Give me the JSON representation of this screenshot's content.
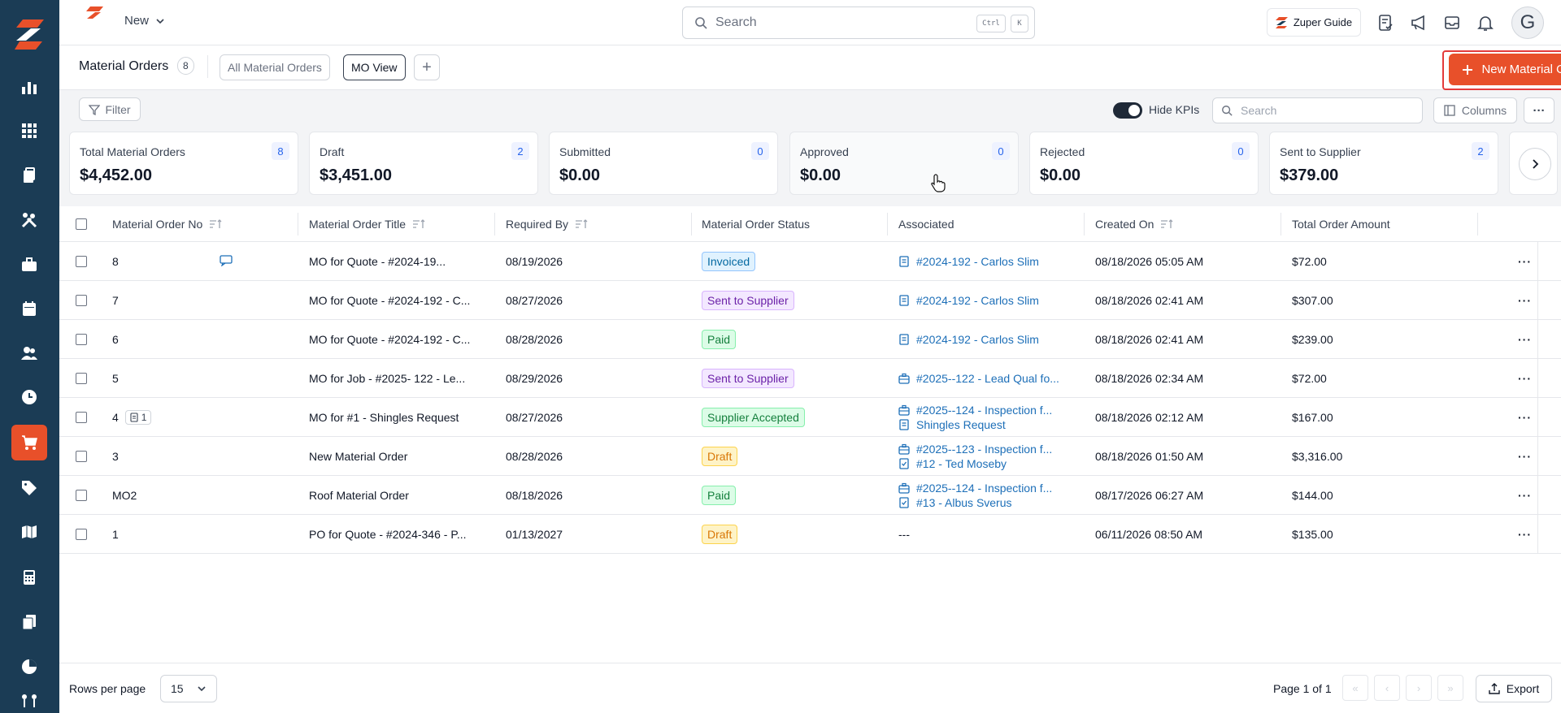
{
  "colors": {
    "sidebar": "#1b3c55",
    "accent": "#e8502a",
    "link": "#1d6fb8"
  },
  "topbar": {
    "new_label": "New",
    "search_placeholder": "Search",
    "kbd_ctrl": "Ctrl",
    "kbd_k": "K",
    "guide_label": "Zuper Guide",
    "avatar_initial": "G"
  },
  "header": {
    "title": "Material Orders",
    "count": "8",
    "tabs": [
      {
        "label": "All Material Orders"
      },
      {
        "label": "MO View"
      }
    ],
    "add_view": "+",
    "cta_label": "New Material Order"
  },
  "toolbar": {
    "filter_label": "Filter",
    "hide_kpis_label": "Hide KPIs",
    "search_placeholder": "Search",
    "columns_label": "Columns",
    "more_label": "···"
  },
  "kpis": [
    {
      "label": "Total Material Orders",
      "count": "8",
      "value": "$4,452.00"
    },
    {
      "label": "Draft",
      "count": "2",
      "value": "$3,451.00"
    },
    {
      "label": "Submitted",
      "count": "0",
      "value": "$0.00"
    },
    {
      "label": "Approved",
      "count": "0",
      "value": "$0.00"
    },
    {
      "label": "Rejected",
      "count": "0",
      "value": "$0.00"
    },
    {
      "label": "Sent to Supplier",
      "count": "2",
      "value": "$379.00"
    }
  ],
  "table": {
    "columns": [
      "Material Order No",
      "Material Order Title",
      "Required By",
      "Material Order Status",
      "Associated",
      "Created On",
      "Total Order Amount"
    ],
    "rows": [
      {
        "no": "8",
        "title": "MO for Quote - #2024-19...",
        "required": "08/19/2026",
        "status": "Invoiced",
        "assoc1": "#2024-192 - Carlos Slim",
        "assoc2": "",
        "created": "08/18/2026 05:05 AM",
        "amount": "$72.00"
      },
      {
        "no": "7",
        "title": "MO for Quote - #2024-192 - C...",
        "required": "08/27/2026",
        "status": "Sent to Supplier",
        "assoc1": "#2024-192 - Carlos Slim",
        "assoc2": "",
        "created": "08/18/2026 02:41 AM",
        "amount": "$307.00"
      },
      {
        "no": "6",
        "title": "MO for Quote - #2024-192 - C...",
        "required": "08/28/2026",
        "status": "Paid",
        "assoc1": "#2024-192 - Carlos Slim",
        "assoc2": "",
        "created": "08/18/2026 02:41 AM",
        "amount": "$239.00"
      },
      {
        "no": "5",
        "title": "MO for Job - #2025- 122 - Le...",
        "required": "08/29/2026",
        "status": "Sent to Supplier",
        "assoc1": "#2025--122 - Lead Qual fo...",
        "assoc2": "",
        "created": "08/18/2026 02:34 AM",
        "amount": "$72.00"
      },
      {
        "no": "4",
        "no_chip": "1",
        "title": "MO for #1 - Shingles Request",
        "required": "08/27/2026",
        "status": "Supplier Accepted",
        "assoc1": "#2025--124 - Inspection f...",
        "assoc2": "Shingles Request",
        "created": "08/18/2026 02:12 AM",
        "amount": "$167.00"
      },
      {
        "no": "3",
        "title": "New Material Order",
        "required": "08/28/2026",
        "status": "Draft",
        "assoc1": "#2025--123 - Inspection f...",
        "assoc2": "#12 - Ted Moseby",
        "created": "08/18/2026 01:50 AM",
        "amount": "$3,316.00"
      },
      {
        "no": "MO2",
        "title": "Roof Material Order",
        "required": "08/18/2026",
        "status": "Paid",
        "assoc1": "#2025--124 - Inspection f...",
        "assoc2": "#13 - Albus Sverus",
        "created": "08/17/2026 06:27 AM",
        "amount": "$144.00"
      },
      {
        "no": "1",
        "title": "PO for Quote - #2024-346 - P...",
        "required": "01/13/2027",
        "status": "Draft",
        "assoc1": "---",
        "assoc2": "",
        "created": "06/11/2026 08:50 AM",
        "amount": "$135.00"
      }
    ],
    "row_more": "···"
  },
  "footer": {
    "rows_per_page_label": "Rows per page",
    "rows_per_page_value": "15",
    "page_info": "Page 1 of 1",
    "export_label": "Export"
  },
  "sidebar_icons": [
    "dashboard-icon",
    "apps-icon",
    "clipboard-icon",
    "tools-icon",
    "briefcase-icon",
    "calendar-icon",
    "users-icon",
    "clock-icon",
    "cart-icon",
    "tag-icon",
    "map-icon",
    "calculator-icon",
    "documents-icon",
    "pie-chart-icon",
    "flow-icon"
  ]
}
